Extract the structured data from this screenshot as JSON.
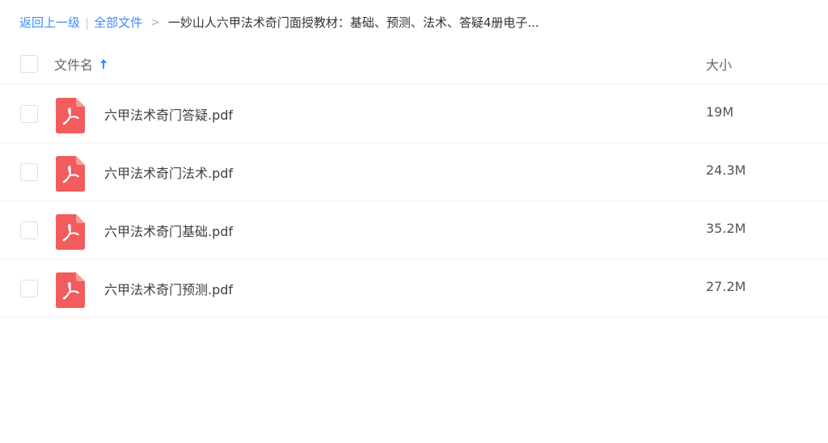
{
  "breadcrumb": {
    "back": "返回上一级",
    "separator": "|",
    "all_files": "全部文件",
    "arrow": ">",
    "current": "一妙山人六甲法术奇门面授教材：基础、预测、法术、答疑4册电子..."
  },
  "header": {
    "name_label": "文件名",
    "size_label": "大小",
    "sort_icon": "arrow-up-icon"
  },
  "files": [
    {
      "name": "六甲法术奇门答疑.pdf",
      "size": "19M",
      "icon": "pdf-icon"
    },
    {
      "name": "六甲法术奇门法术.pdf",
      "size": "24.3M",
      "icon": "pdf-icon"
    },
    {
      "name": "六甲法术奇门基础.pdf",
      "size": "35.2M",
      "icon": "pdf-icon"
    },
    {
      "name": "六甲法术奇门预测.pdf",
      "size": "27.2M",
      "icon": "pdf-icon"
    }
  ],
  "colors": {
    "link": "#3b8cff",
    "pdf_icon": "#f25c5c"
  }
}
